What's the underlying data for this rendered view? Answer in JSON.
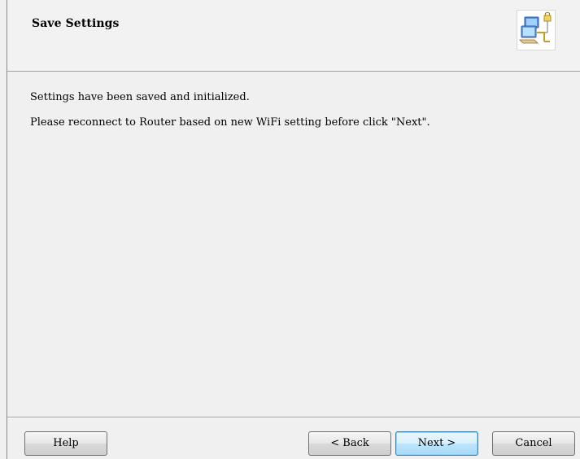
{
  "header": {
    "title": "Save Settings",
    "icon": "network-computers-icon"
  },
  "content": {
    "message_1": "Settings have been saved and initialized.",
    "message_2": "Please reconnect to Router based on new WiFi setting before click \"Next\"."
  },
  "buttons": {
    "help": "Help",
    "back": "< Back",
    "next": "Next >",
    "cancel": "Cancel"
  },
  "colors": {
    "background": "#f0f0f0",
    "default_button_border": "#3c7fb1"
  }
}
